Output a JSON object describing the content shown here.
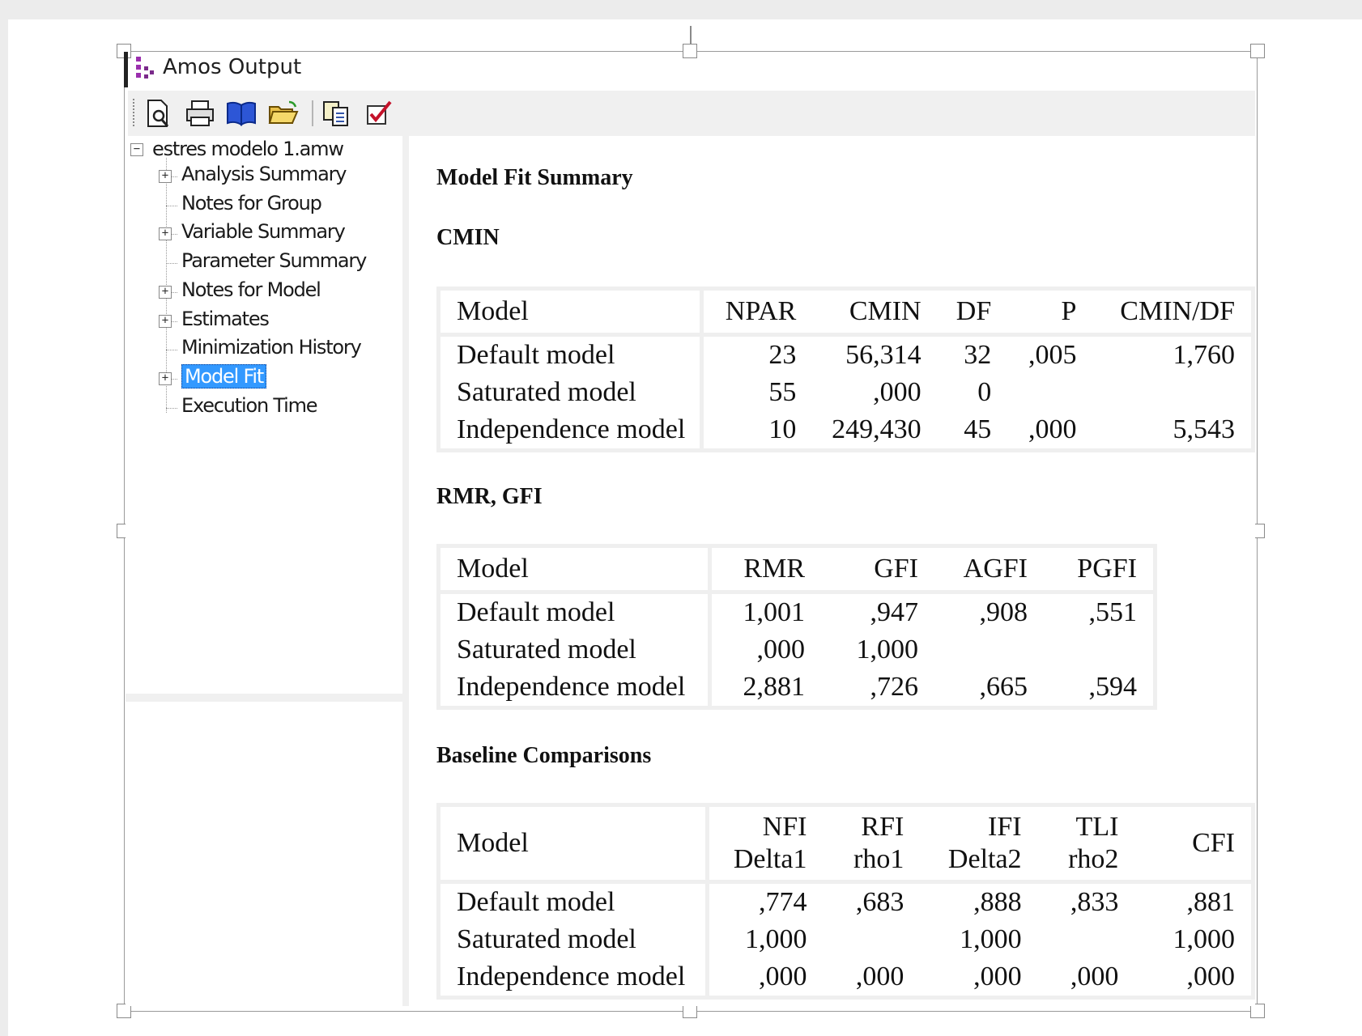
{
  "window": {
    "title": "Amos Output"
  },
  "toolbar": {
    "buttons": [
      "print-preview-icon",
      "print-icon",
      "book-icon",
      "open-folder-icon",
      "copy-icon",
      "options-check-icon"
    ]
  },
  "tree": {
    "root": "estres modelo 1.amw",
    "items": [
      {
        "label": "Analysis Summary",
        "expandable": true
      },
      {
        "label": "Notes for Group",
        "expandable": false
      },
      {
        "label": "Variable Summary",
        "expandable": true
      },
      {
        "label": "Parameter Summary",
        "expandable": false
      },
      {
        "label": "Notes for Model",
        "expandable": true
      },
      {
        "label": "Estimates",
        "expandable": true
      },
      {
        "label": "Minimization History",
        "expandable": false
      },
      {
        "label": "Model Fit",
        "expandable": true,
        "selected": true
      },
      {
        "label": "Execution Time",
        "expandable": false
      }
    ]
  },
  "content": {
    "heading": "Model Fit Summary",
    "cmin": {
      "title": "CMIN",
      "columns": [
        "Model",
        "NPAR",
        "CMIN",
        "DF",
        "P",
        "CMIN/DF"
      ],
      "rows": [
        [
          "Default model",
          "23",
          "56,314",
          "32",
          ",005",
          "1,760"
        ],
        [
          "Saturated model",
          "55",
          ",000",
          "0",
          "",
          ""
        ],
        [
          "Independence model",
          "10",
          "249,430",
          "45",
          ",000",
          "5,543"
        ]
      ]
    },
    "rmr": {
      "title": "RMR, GFI",
      "columns": [
        "Model",
        "RMR",
        "GFI",
        "AGFI",
        "PGFI"
      ],
      "rows": [
        [
          "Default model",
          "1,001",
          ",947",
          ",908",
          ",551"
        ],
        [
          "Saturated model",
          ",000",
          "1,000",
          "",
          ""
        ],
        [
          "Independence model",
          "2,881",
          ",726",
          ",665",
          ",594"
        ]
      ]
    },
    "baseline": {
      "title": "Baseline Comparisons",
      "columns": [
        [
          "Model"
        ],
        [
          "NFI",
          "Delta1"
        ],
        [
          "RFI",
          "rho1"
        ],
        [
          "IFI",
          "Delta2"
        ],
        [
          "TLI",
          "rho2"
        ],
        [
          "CFI"
        ]
      ],
      "rows": [
        [
          "Default model",
          ",774",
          ",683",
          ",888",
          ",833",
          ",881"
        ],
        [
          "Saturated model",
          "1,000",
          "",
          "1,000",
          "",
          "1,000"
        ],
        [
          "Independence model",
          ",000",
          ",000",
          ",000",
          ",000",
          ",000"
        ]
      ]
    }
  }
}
